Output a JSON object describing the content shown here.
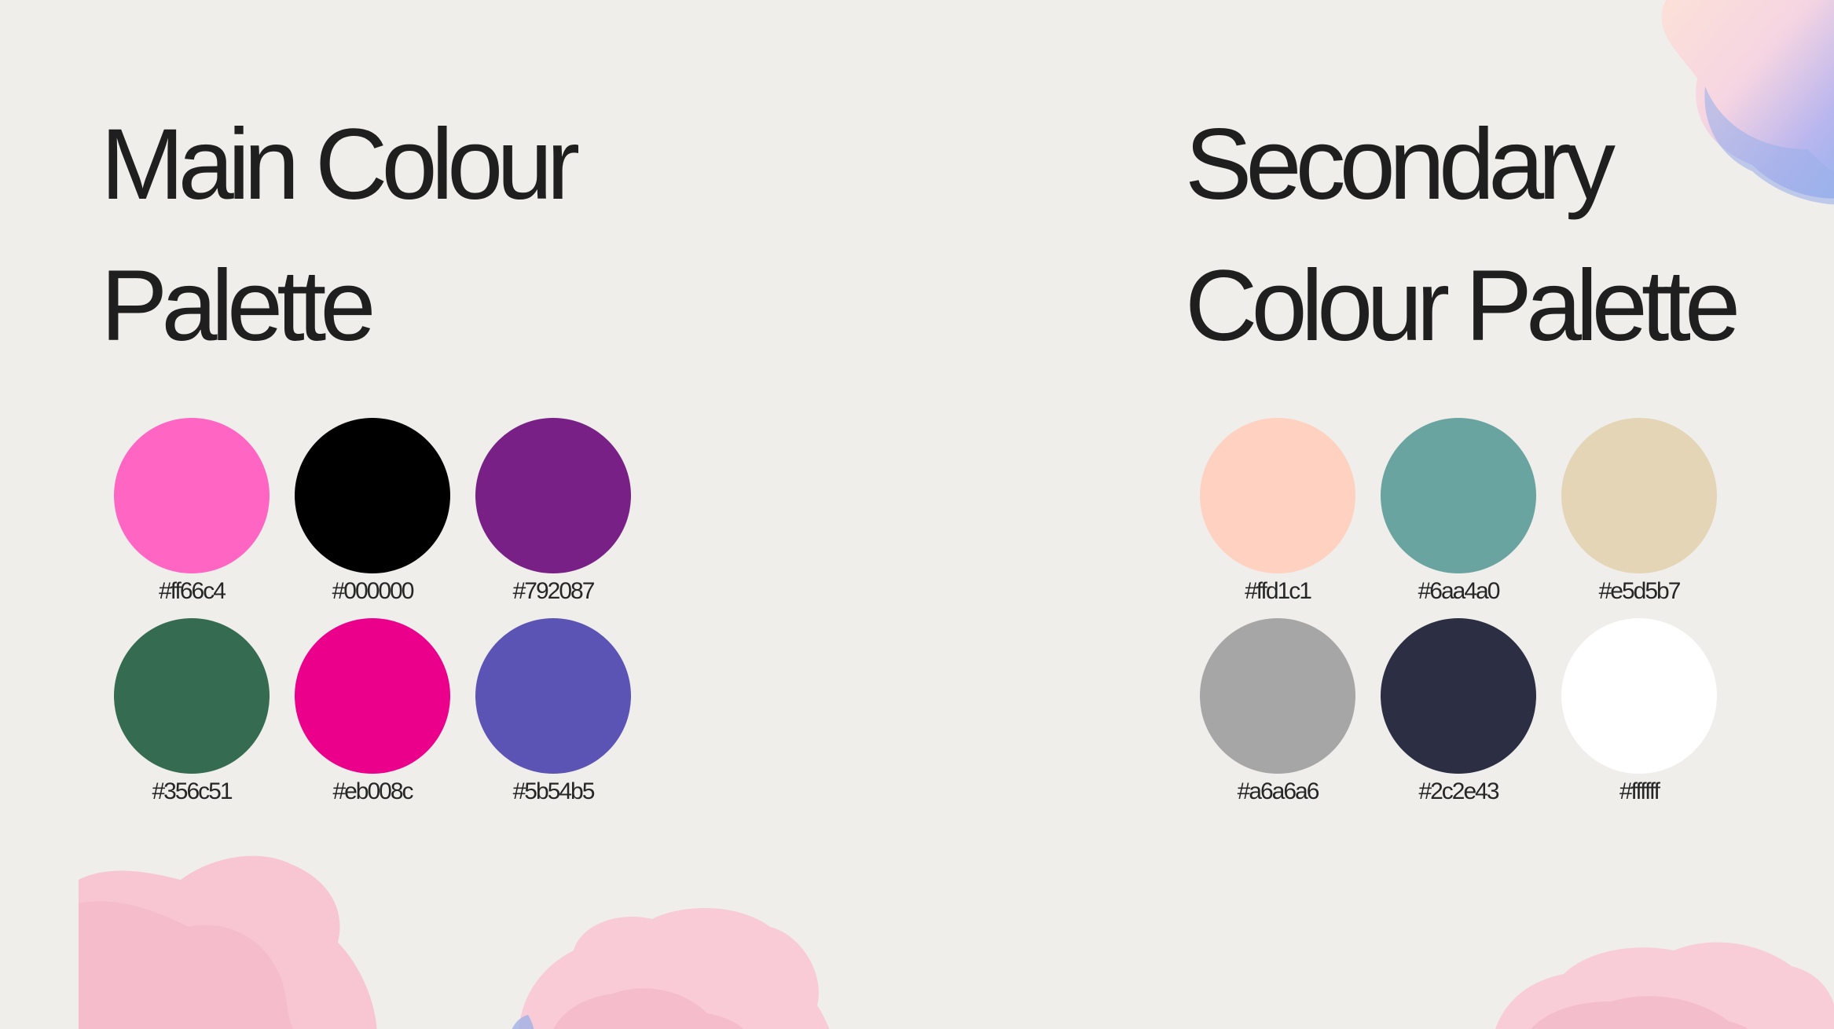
{
  "main_palette": {
    "title_line1": "Main Colour",
    "title_line2": "Palette",
    "swatches": [
      {
        "label": "#ff66c4",
        "color": "#ff66c4"
      },
      {
        "label": "#000000",
        "color": "#000000"
      },
      {
        "label": "#792087",
        "color": "#792087"
      },
      {
        "label": "#356c51",
        "color": "#356c51"
      },
      {
        "label": "#eb008c",
        "color": "#eb008c"
      },
      {
        "label": "#5b54b5",
        "color": "#5b54b5"
      }
    ]
  },
  "secondary_palette": {
    "title_line1": "Secondary",
    "title_line2": "Colour Palette",
    "swatches": [
      {
        "label": "#ffd1c1",
        "color": "#ffd1c1"
      },
      {
        "label": "#6aa4a0",
        "color": "#6aa4a0"
      },
      {
        "label": "#e5d5b7",
        "color": "#e5d5b7"
      },
      {
        "label": "#a6a6a6",
        "color": "#a6a6a6"
      },
      {
        "label": "#2c2e43",
        "color": "#2c2e43"
      },
      {
        "label": "#ffffff",
        "color": "#ffffff"
      }
    ]
  }
}
